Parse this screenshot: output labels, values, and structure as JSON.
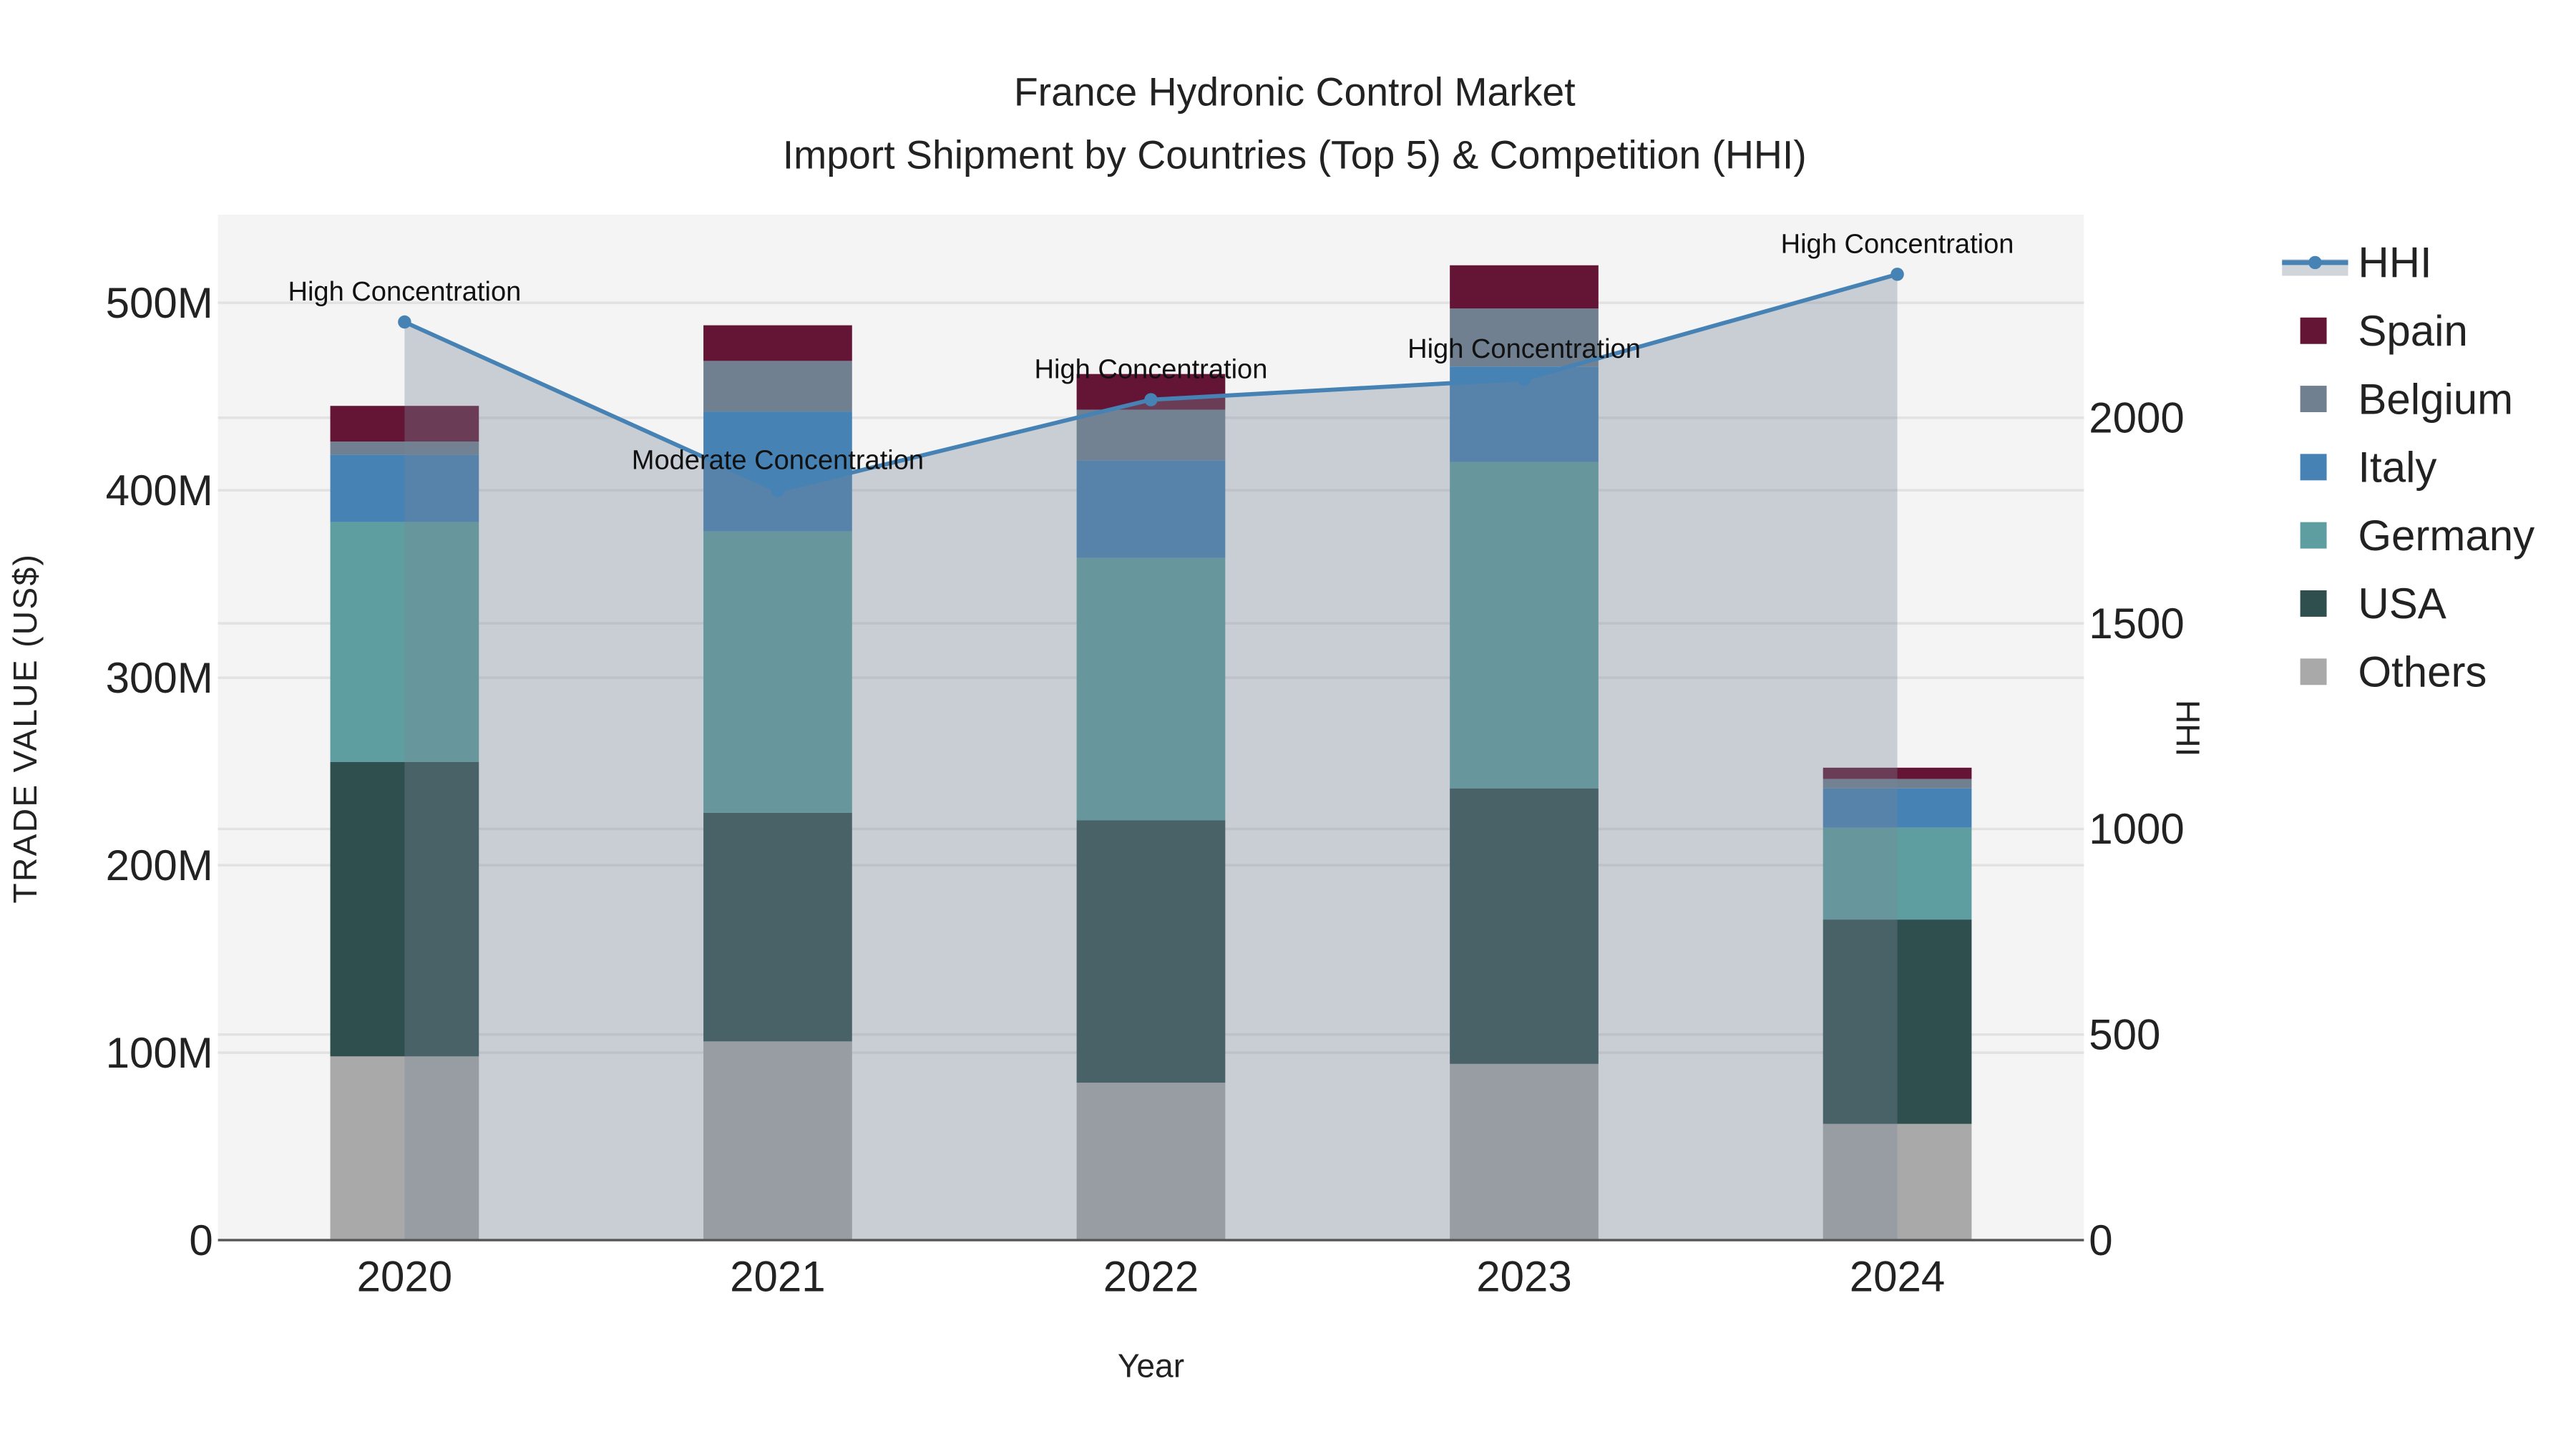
{
  "chart_data": {
    "type": "bar",
    "stacked": true,
    "title_line1": "France Hydronic Control Market",
    "title_line2": "Import Shipment by Countries (Top 5) & Competition (HHI)",
    "xlabel": "Year",
    "ylabel": "TRADE VALUE (US$)",
    "y2label": "HHI",
    "categories": [
      "2020",
      "2021",
      "2022",
      "2023",
      "2024"
    ],
    "ylim": [
      0,
      547
    ],
    "y_unit": "M",
    "yticks": [
      0,
      100,
      200,
      300,
      400,
      500
    ],
    "ytick_labels": [
      "0",
      "100M",
      "200M",
      "300M",
      "400M",
      "500M"
    ],
    "y2lim": [
      0,
      2494
    ],
    "y2ticks": [
      0,
      500,
      1000,
      1500,
      2000
    ],
    "y2tick_labels": [
      "0",
      "500",
      "1000",
      "1500",
      "2000"
    ],
    "grid": true,
    "legend_placement": "right",
    "series": [
      {
        "name": "Others",
        "color": "#A9A9A9",
        "values": [
          98,
          106,
          84,
          94,
          62
        ]
      },
      {
        "name": "USA",
        "color": "#2F4F4F",
        "values": [
          157,
          122,
          140,
          147,
          109
        ]
      },
      {
        "name": "Germany",
        "color": "#5F9EA0",
        "values": [
          128,
          150,
          140,
          174,
          49
        ]
      },
      {
        "name": "Italy",
        "color": "#4682B4",
        "values": [
          36,
          64,
          52,
          51,
          21
        ]
      },
      {
        "name": "Belgium",
        "color": "#708090",
        "values": [
          7,
          27,
          27,
          31,
          5
        ]
      },
      {
        "name": "Spain",
        "color": "#641434",
        "values": [
          19,
          19,
          19,
          23,
          6
        ]
      }
    ],
    "hhi": {
      "name": "HHI",
      "color": "#4682B4",
      "area_color": "#778899",
      "values": [
        2233,
        1823,
        2044,
        2094,
        2349
      ],
      "annotations": [
        "High Concentration",
        "Moderate Concentration",
        "High Concentration",
        "High Concentration",
        "High Concentration"
      ]
    },
    "legend_order": [
      "HHI",
      "Spain",
      "Belgium",
      "Italy",
      "Germany",
      "USA",
      "Others"
    ]
  }
}
